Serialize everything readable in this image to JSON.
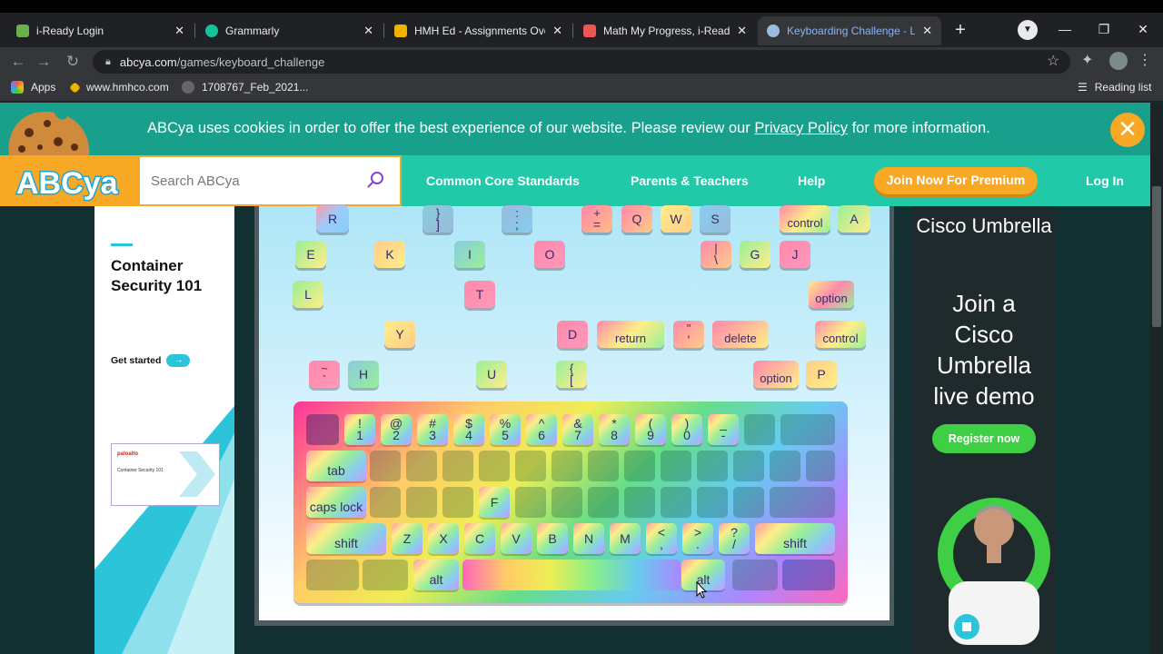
{
  "browser": {
    "tabs": [
      {
        "title": "i-Ready Login",
        "color": "#6ab04c",
        "active": false
      },
      {
        "title": "Grammarly",
        "color": "#15c39a",
        "active": false
      },
      {
        "title": "HMH Ed - Assignments Overv",
        "color": "#f0b400",
        "active": false
      },
      {
        "title": "Math My Progress, i-Ready",
        "color": "#e55",
        "active": false
      },
      {
        "title": "Keyboarding Challenge - Lea",
        "color": "#9bd",
        "active": true
      }
    ],
    "new_tab_icon": "+",
    "tab_search_icon": "chevron-down-icon",
    "window_buttons": {
      "minimize": "—",
      "restore": "❐",
      "close": "✕"
    },
    "url_host": "abcya.com",
    "url_path": "/games/keyboard_challenge",
    "bookmarks": [
      {
        "label": "Apps",
        "color": "#e55"
      },
      {
        "label": "www.hmhco.com",
        "color": "#f0b400"
      },
      {
        "label": "1708767_Feb_2021...",
        "color": "#888"
      }
    ],
    "reading_list": "Reading list"
  },
  "cookie": {
    "text_before": "ABCya uses cookies in order to offer the best experience of our website. Please review our ",
    "link": "Privacy Policy",
    "text_after": " for more information.",
    "close": "✕"
  },
  "header": {
    "logo": "ABCya",
    "search_placeholder": "Search ABCya",
    "nav": [
      "Common Core Standards",
      "Parents & Teachers",
      "Help"
    ],
    "premium": "Join Now For Premium",
    "login": "Log In"
  },
  "left_ad": {
    "title": "Container Security 101",
    "cta": "Get started",
    "thumb_brand": "paloalto",
    "thumb_title": "Container Security 101"
  },
  "right_ad": {
    "top_text": "Cisco Umbrella",
    "big_text": "Join a Cisco Umbrella live demo",
    "button": "Register now"
  },
  "game": {
    "floating_keys": [
      {
        "label": "R",
        "color": "#8cd"
      },
      {
        "top": "}",
        "label": "]",
        "color": "#8cd"
      },
      {
        "top": ":",
        "label": ";",
        "color": "#9bd"
      },
      {
        "top": "+",
        "label": "=",
        "color": "#f8a"
      },
      {
        "label": "Q",
        "color": "#f8a"
      },
      {
        "label": "W",
        "color": "#fe8"
      },
      {
        "label": "S",
        "color": "#8ce"
      },
      {
        "label": "control",
        "color": "#f8a"
      },
      {
        "label": "A",
        "color": "#9e9"
      },
      {
        "label": "E",
        "color": "#9e9"
      },
      {
        "label": "K",
        "color": "#fc8"
      },
      {
        "label": "I",
        "color": "#8cd"
      },
      {
        "label": "O",
        "color": "#f8a"
      },
      {
        "top": "|",
        "label": "\\",
        "color": "#f8a"
      },
      {
        "label": "G",
        "color": "#9e9"
      },
      {
        "label": "J",
        "color": "#f8a"
      },
      {
        "label": "L",
        "color": "#9e9"
      },
      {
        "label": "T",
        "color": "#f8a"
      },
      {
        "label": "option",
        "color": "#fe8"
      },
      {
        "label": "Y",
        "color": "#fe8"
      },
      {
        "label": "D",
        "color": "#f8a"
      },
      {
        "label": "return",
        "color": "#f8a"
      },
      {
        "top": "\"",
        "label": "'",
        "color": "#f8a"
      },
      {
        "label": "delete",
        "color": "#f8a"
      },
      {
        "label": "control",
        "color": "#f8a"
      },
      {
        "top": "~",
        "label": "`",
        "color": "#f8a"
      },
      {
        "label": "H",
        "color": "#8cd"
      },
      {
        "label": "U",
        "color": "#9e9"
      },
      {
        "top": "{",
        "label": "[",
        "color": "#9e9"
      },
      {
        "label": "option",
        "color": "#f8a"
      },
      {
        "label": "P",
        "color": "#fc8"
      }
    ],
    "keyboard": {
      "row1": [
        {
          "t": "",
          "b": "",
          "lit": false,
          "lit_dark": true
        },
        {
          "t": "!",
          "b": "1",
          "lit": true
        },
        {
          "t": "@",
          "b": "2",
          "lit": true
        },
        {
          "t": "#",
          "b": "3",
          "lit": true
        },
        {
          "t": "$",
          "b": "4",
          "lit": true
        },
        {
          "t": "%",
          "b": "5",
          "lit": true
        },
        {
          "t": "^",
          "b": "6",
          "lit": true
        },
        {
          "t": "&",
          "b": "7",
          "lit": true
        },
        {
          "t": "*",
          "b": "8",
          "lit": true
        },
        {
          "t": "(",
          "b": "9",
          "lit": true
        },
        {
          "t": ")",
          "b": "0",
          "lit": true
        },
        {
          "t": "_",
          "b": "-",
          "lit": true
        },
        {
          "t": "",
          "b": "",
          "lit": false
        },
        {
          "t": "",
          "b": "",
          "lit": false
        }
      ],
      "row2": [
        {
          "b": "tab",
          "lit": true
        }
      ],
      "row3": [
        {
          "b": "caps lock",
          "lit": true
        },
        {
          "b": "F",
          "lit": true
        }
      ],
      "row4": [
        {
          "b": "shift",
          "lit": true
        },
        {
          "b": "Z",
          "lit": true
        },
        {
          "b": "X",
          "lit": true
        },
        {
          "b": "C",
          "lit": true
        },
        {
          "b": "V",
          "lit": true
        },
        {
          "b": "B",
          "lit": true
        },
        {
          "b": "N",
          "lit": true
        },
        {
          "b": "M",
          "lit": true
        },
        {
          "t": "<",
          "b": ",",
          "lit": true
        },
        {
          "t": ">",
          "b": ".",
          "lit": true
        },
        {
          "t": "?",
          "b": "/",
          "lit": true
        },
        {
          "b": "shift",
          "lit": true
        }
      ],
      "row5": [
        {
          "b": "alt",
          "lit": true
        },
        {
          "b": "",
          "lit": true
        },
        {
          "b": "alt",
          "lit": true
        }
      ]
    }
  }
}
